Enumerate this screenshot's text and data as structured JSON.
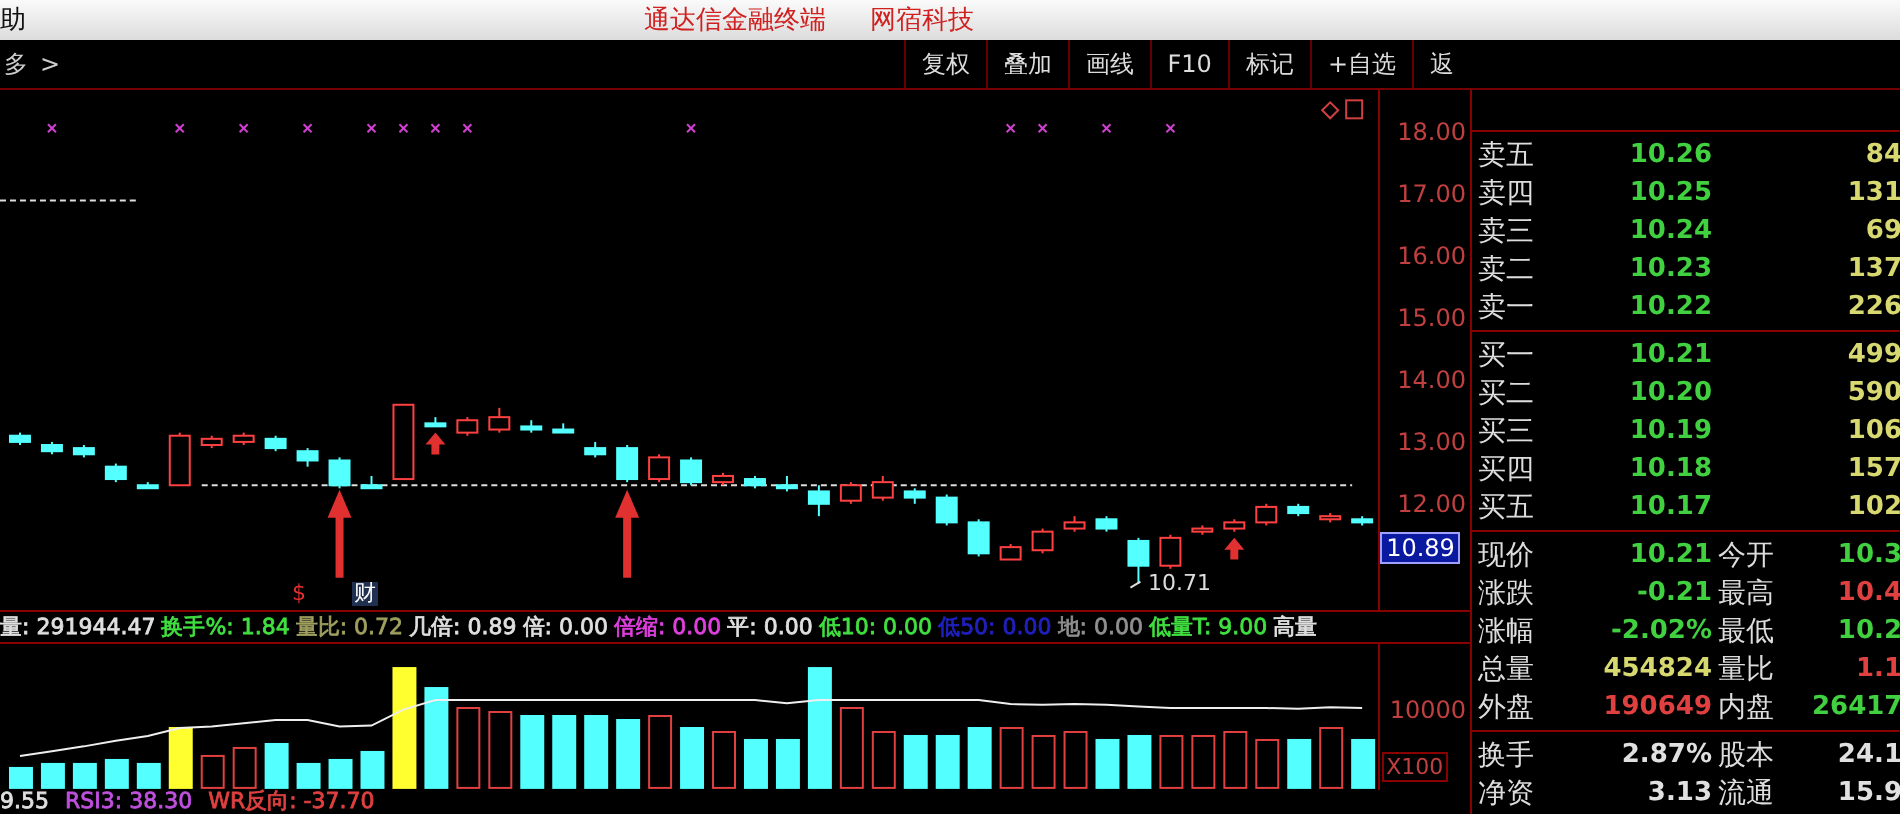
{
  "title_bar": {
    "menu_item": "助",
    "app_name": "通达信金融终端",
    "vendor": "网宿科技"
  },
  "toolbar": {
    "breadcrumb": "多",
    "chevron": ">",
    "buttons": [
      "复权",
      "叠加",
      "画线",
      "F10",
      "标记",
      "+自选",
      "返"
    ]
  },
  "price_chart": {
    "current_price_tag": "10.89",
    "low_label": "10.71",
    "markers": [
      {
        "text": "$",
        "kind": "dividend"
      },
      {
        "text": "财",
        "kind": "report"
      }
    ],
    "chart_data": {
      "type": "candlestick",
      "ylim": [
        10.29,
        18.68
      ],
      "ohlc": [
        [
          13.1,
          13.15,
          12.95,
          13.0
        ],
        [
          12.95,
          13.0,
          12.8,
          12.85
        ],
        [
          12.9,
          12.95,
          12.75,
          12.8
        ],
        [
          12.6,
          12.65,
          12.35,
          12.4
        ],
        [
          12.3,
          12.35,
          12.25,
          12.3
        ],
        [
          12.3,
          13.15,
          12.3,
          13.1
        ],
        [
          12.95,
          13.1,
          12.9,
          13.05
        ],
        [
          13.0,
          13.15,
          12.95,
          13.1
        ],
        [
          13.05,
          13.1,
          12.85,
          12.9
        ],
        [
          12.85,
          12.9,
          12.6,
          12.7
        ],
        [
          12.7,
          12.75,
          12.25,
          12.3
        ],
        [
          12.3,
          12.45,
          12.25,
          12.3
        ],
        [
          12.4,
          13.6,
          12.4,
          13.6
        ],
        [
          13.3,
          13.4,
          13.25,
          13.3
        ],
        [
          13.15,
          13.4,
          13.1,
          13.35
        ],
        [
          13.2,
          13.55,
          13.15,
          13.4
        ],
        [
          13.25,
          13.35,
          13.15,
          13.2
        ],
        [
          13.2,
          13.3,
          13.15,
          13.2
        ],
        [
          12.9,
          13.0,
          12.75,
          12.8
        ],
        [
          12.9,
          12.95,
          12.35,
          12.4
        ],
        [
          12.4,
          12.8,
          12.35,
          12.75
        ],
        [
          12.7,
          12.75,
          12.3,
          12.35
        ],
        [
          12.35,
          12.5,
          12.3,
          12.45
        ],
        [
          12.4,
          12.45,
          12.25,
          12.3
        ],
        [
          12.3,
          12.45,
          12.2,
          12.3
        ],
        [
          12.2,
          12.3,
          11.8,
          12.0
        ],
        [
          12.05,
          12.35,
          12.0,
          12.3
        ],
        [
          12.1,
          12.45,
          12.05,
          12.35
        ],
        [
          12.2,
          12.25,
          12.0,
          12.1
        ],
        [
          12.1,
          12.15,
          11.65,
          11.7
        ],
        [
          11.7,
          11.75,
          11.15,
          11.2
        ],
        [
          11.1,
          11.35,
          11.1,
          11.3
        ],
        [
          11.25,
          11.6,
          11.2,
          11.55
        ],
        [
          11.6,
          11.8,
          11.55,
          11.7
        ],
        [
          11.75,
          11.8,
          11.55,
          11.6
        ],
        [
          11.4,
          11.45,
          10.71,
          11.0
        ],
        [
          11.0,
          11.5,
          10.95,
          11.45
        ],
        [
          11.55,
          11.65,
          11.5,
          11.6
        ],
        [
          11.6,
          11.75,
          11.55,
          11.7
        ],
        [
          11.7,
          12.0,
          11.65,
          11.95
        ],
        [
          11.95,
          12.0,
          11.8,
          11.85
        ],
        [
          11.75,
          11.85,
          11.7,
          11.8
        ],
        [
          11.75,
          11.8,
          11.65,
          11.7
        ]
      ],
      "ref_lines": [
        {
          "axis": "y",
          "value": 16.9
        },
        {
          "axis": "y",
          "value": 12.3
        }
      ],
      "yticks": [
        {
          "value": 18,
          "label": "18.00"
        },
        {
          "value": 17,
          "label": "17.00"
        },
        {
          "value": 16,
          "label": "16.00"
        },
        {
          "value": 15,
          "label": "15.00"
        },
        {
          "value": 14,
          "label": "14.00"
        },
        {
          "value": 13,
          "label": "13.00"
        },
        {
          "value": 12,
          "label": "12.00"
        }
      ]
    }
  },
  "indicator_bar": [
    {
      "text": "量: 291944.47",
      "color": "#e0e0e0"
    },
    {
      "text": "换手%: 1.84",
      "color": "#40e040"
    },
    {
      "text": "量比: 0.72",
      "color": "#a0a060"
    },
    {
      "text": "几倍: 0.89",
      "color": "#e0e0e0"
    },
    {
      "text": "倍: 0.00",
      "color": "#e0e0e0"
    },
    {
      "text": "倍缩: 0.00",
      "color": "#e040e0"
    },
    {
      "text": "平: 0.00",
      "color": "#e0e0e0"
    },
    {
      "text": "低10: 0.00",
      "color": "#40e040"
    },
    {
      "text": "低50: 0.00",
      "color": "#2020c0"
    },
    {
      "text": "地: 0.00",
      "color": "#909090"
    },
    {
      "text": "低量T: 9.00",
      "color": "#40e040"
    },
    {
      "text": "高量",
      "color": "#e0e0e0"
    }
  ],
  "volume_chart": {
    "axis_label": "10000",
    "scale_label": "X100"
  },
  "footer_indicators": [
    {
      "text": "9.55",
      "color": "#e0e0e0"
    },
    {
      "text": "RSI3: 38.30",
      "color": "#c050e0"
    },
    {
      "text": "WR反向: -37.70",
      "color": "#e04040"
    }
  ],
  "order_book": {
    "asks": [
      {
        "label": "卖五",
        "price": "10.26",
        "volume": "84"
      },
      {
        "label": "卖四",
        "price": "10.25",
        "volume": "131"
      },
      {
        "label": "卖三",
        "price": "10.24",
        "volume": "69"
      },
      {
        "label": "卖二",
        "price": "10.23",
        "volume": "137"
      },
      {
        "label": "卖一",
        "price": "10.22",
        "volume": "226"
      }
    ],
    "bids": [
      {
        "label": "买一",
        "price": "10.21",
        "volume": "499"
      },
      {
        "label": "买二",
        "price": "10.20",
        "volume": "590"
      },
      {
        "label": "买三",
        "price": "10.19",
        "volume": "106"
      },
      {
        "label": "买四",
        "price": "10.18",
        "volume": "157"
      },
      {
        "label": "买五",
        "price": "10.17",
        "volume": "102"
      }
    ]
  },
  "quote": [
    [
      {
        "label": "现价",
        "value": "10.21",
        "color": "#40d040"
      },
      {
        "label": "今开",
        "value": "10.3",
        "color": "#40d040"
      }
    ],
    [
      {
        "label": "涨跌",
        "value": "-0.21",
        "color": "#40d040"
      },
      {
        "label": "最高",
        "value": "10.4",
        "color": "#e04040"
      }
    ],
    [
      {
        "label": "涨幅",
        "value": "-2.02%",
        "color": "#40d040"
      },
      {
        "label": "最低",
        "value": "10.2",
        "color": "#40d040"
      }
    ],
    [
      {
        "label": "总量",
        "value": "454824",
        "color": "#d8d870"
      },
      {
        "label": "量比",
        "value": "1.1",
        "color": "#e04040"
      }
    ],
    [
      {
        "label": "外盘",
        "value": "190649",
        "color": "#e04040"
      },
      {
        "label": "内盘",
        "value": "26417",
        "color": "#40d040"
      }
    ]
  ],
  "shares": [
    [
      {
        "label": "换手",
        "value": "2.87%",
        "color": "#e0e0e0"
      },
      {
        "label": "股本",
        "value": "24.1",
        "color": "#e0e0e0"
      }
    ],
    [
      {
        "label": "净资",
        "value": "3.13",
        "color": "#e0e0e0"
      },
      {
        "label": "流通",
        "value": "15.9",
        "color": "#e0e0e0"
      }
    ]
  ]
}
